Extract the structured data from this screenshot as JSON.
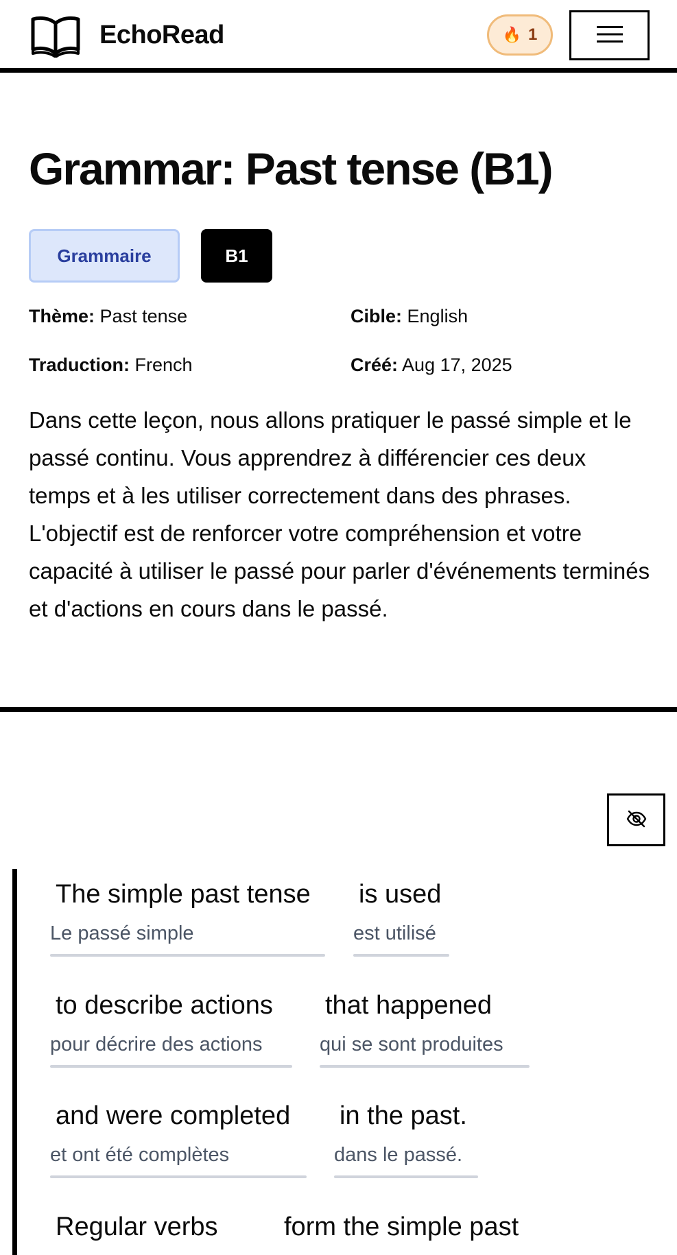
{
  "header": {
    "logo_icon": "open-book-icon",
    "app_title": "EchoRead",
    "streak": {
      "icon": "fire-icon",
      "emoji": "🔥",
      "count": "1"
    },
    "menu_icon": "hamburger-menu-icon"
  },
  "lesson": {
    "title": "Grammar: Past tense (B1)",
    "category_tag": "Grammaire",
    "level_tag": "B1",
    "meta": {
      "theme_label": "Thème:",
      "theme_value": "Past tense",
      "target_label": "Cible:",
      "target_value": "English",
      "translation_label": "Traduction:",
      "translation_value": "French",
      "created_label": "Créé:",
      "created_value": "Aug 17, 2025"
    },
    "description": "Dans cette leçon, nous allons pratiquer le passé simple et le passé continu. Vous apprendrez à différencier ces deux temps et à les utiliser correctement dans des phrases. L'objectif est de renforcer votre compréhension et votre capacité à utiliser le passé pour parler d'événements terminés et d'actions en cours dans le passé."
  },
  "reading": {
    "toggle_icon": "eye-off-icon",
    "chunks": [
      {
        "en": "The simple past tense",
        "fr": "Le passé simple"
      },
      {
        "en": "is used",
        "fr": "est utilisé"
      },
      {
        "en": "to describe actions",
        "fr": "pour décrire des actions"
      },
      {
        "en": "that happened",
        "fr": "qui se sont produites"
      },
      {
        "en": "and were completed",
        "fr": "et ont été complètes"
      },
      {
        "en": "in the past.",
        "fr": "dans le passé."
      },
      {
        "en": "Regular verbs",
        "fr": ""
      },
      {
        "en": "form the simple past",
        "fr": ""
      }
    ]
  }
}
